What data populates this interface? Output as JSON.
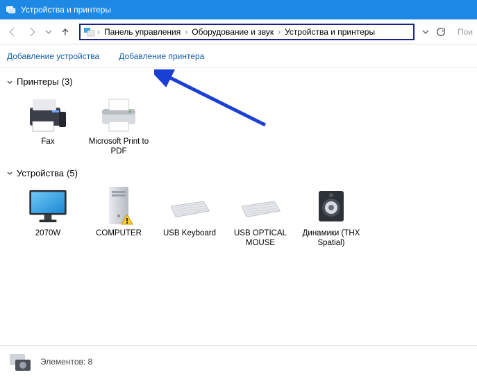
{
  "window": {
    "title": "Устройства и принтеры"
  },
  "breadcrumb": {
    "items": [
      "Панель управления",
      "Оборудование и звук",
      "Устройства и принтеры"
    ]
  },
  "search": {
    "placeholder": "Пои"
  },
  "commands": {
    "add_device": "Добавление устройства",
    "add_printer": "Добавление принтера"
  },
  "groups": {
    "printers": {
      "label": "Принтеры",
      "count": "(3)",
      "items": [
        {
          "label": "Fax"
        },
        {
          "label": "Microsoft Print to PDF"
        }
      ]
    },
    "devices": {
      "label": "Устройства",
      "count": "(5)",
      "items": [
        {
          "label": "2070W"
        },
        {
          "label": "COMPUTER"
        },
        {
          "label": "USB Keyboard"
        },
        {
          "label": "USB OPTICAL MOUSE"
        },
        {
          "label": "Динамики (THX Spatial)"
        }
      ]
    }
  },
  "status": {
    "elements_label": "Элементов:",
    "elements_count": "8"
  }
}
